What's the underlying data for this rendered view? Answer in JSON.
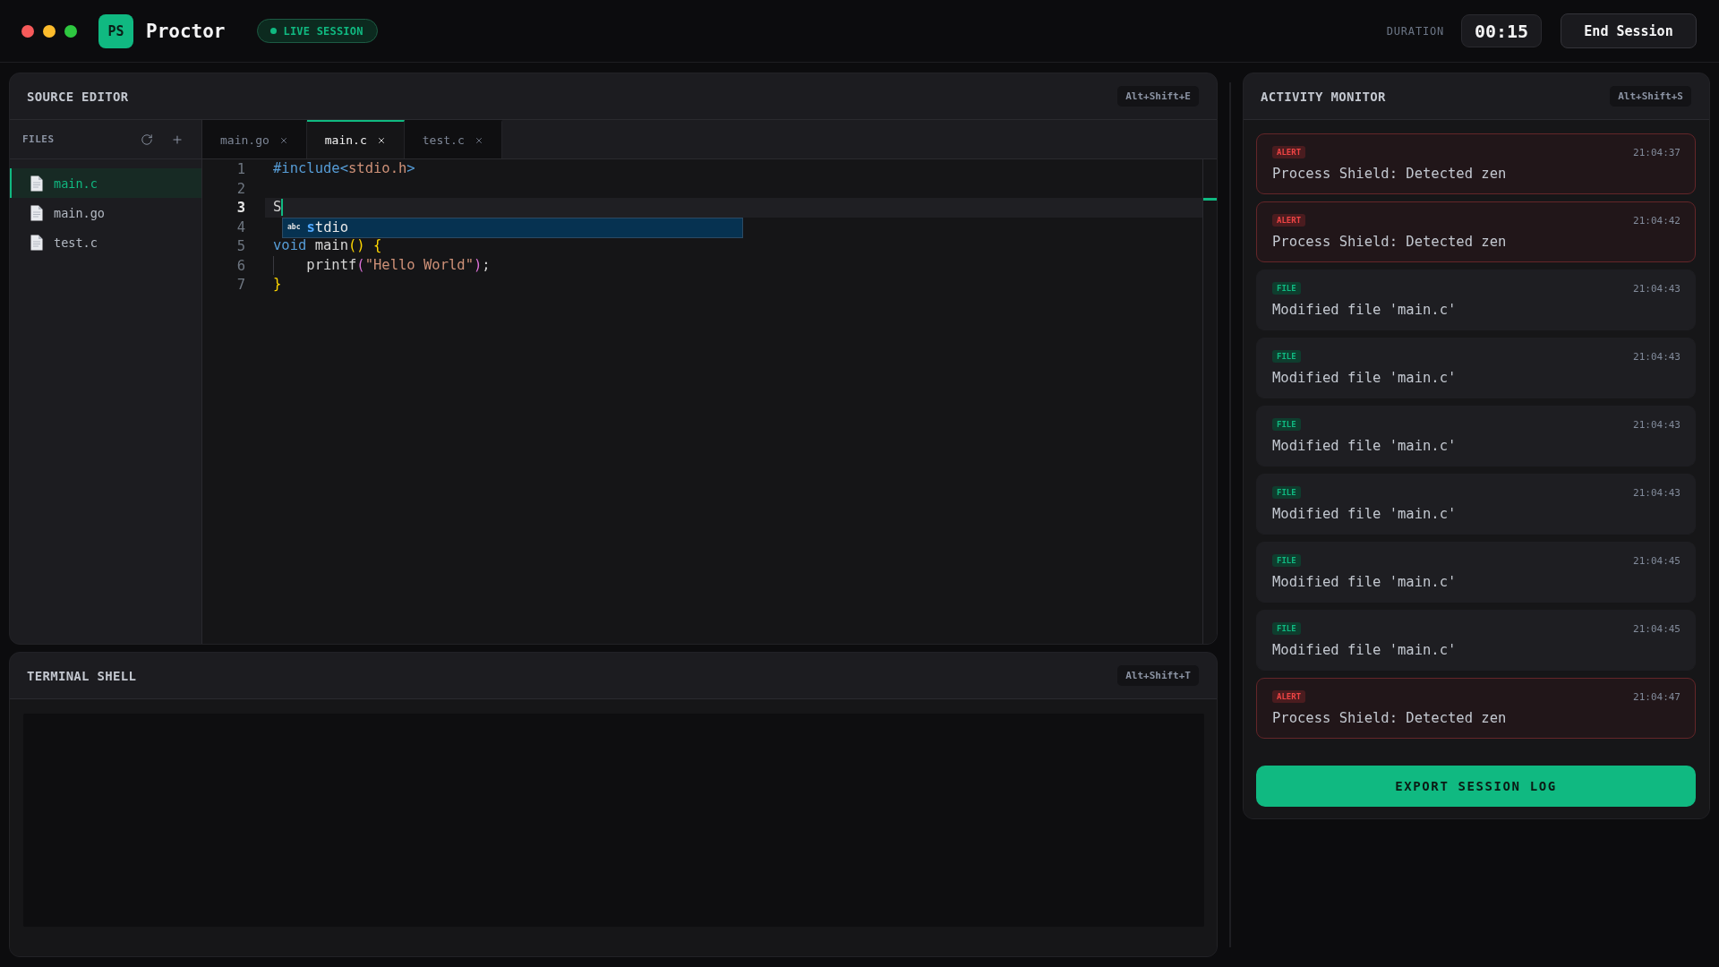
{
  "window": {
    "controls": [
      {
        "color": "#f75a5a"
      },
      {
        "color": "#fdbc2c"
      },
      {
        "color": "#2ec840"
      }
    ]
  },
  "header": {
    "logo": "PS",
    "app_name": "Proctor",
    "session_status": {
      "label": "LIVE SESSION",
      "live": true
    },
    "duration_label": "DURATION",
    "duration": "00:15",
    "end_button": "End Session"
  },
  "editor": {
    "title": "SOURCE EDITOR",
    "shortcut": "Alt+Shift+E",
    "files_heading": "FILES",
    "files": [
      {
        "name": "main.c",
        "selected": true
      },
      {
        "name": "main.go",
        "selected": false
      },
      {
        "name": "test.c",
        "selected": false
      }
    ],
    "tabs": [
      {
        "label": "main.go",
        "selected": false
      },
      {
        "label": "main.c",
        "selected": true
      },
      {
        "label": "test.c",
        "selected": false
      }
    ],
    "lines": [
      {
        "number": "1",
        "current": false,
        "indented": false,
        "tokens": [
          {
            "kind": "keyword",
            "text": "#include<"
          },
          {
            "kind": "string",
            "text": "stdio.h"
          },
          {
            "kind": "keyword",
            "text": ">"
          }
        ]
      },
      {
        "number": "2",
        "current": false,
        "indented": false
      },
      {
        "number": "3",
        "current": true,
        "indented": false,
        "tokens": [
          {
            "kind": "plain",
            "text": "S"
          }
        ]
      },
      {
        "number": "4",
        "current": false,
        "indented": false
      },
      {
        "number": "5",
        "current": false,
        "indented": false,
        "tokens": [
          {
            "kind": "keyword",
            "text": "void"
          },
          {
            "kind": "plain",
            "text": " main"
          },
          {
            "kind": "bracket",
            "text": "()"
          },
          {
            "kind": "bracket",
            "text": " {"
          }
        ]
      },
      {
        "number": "6",
        "current": false,
        "indented": true,
        "tokens": [
          {
            "kind": "plain",
            "text": "printf"
          },
          {
            "kind": "paren",
            "text": "("
          },
          {
            "kind": "string",
            "text": "\"Hello World\""
          },
          {
            "kind": "paren",
            "text": ")"
          },
          {
            "kind": "plain",
            "text": ";"
          }
        ]
      },
      {
        "number": "7",
        "current": false,
        "indented": false,
        "tokens": [
          {
            "kind": "bracket",
            "text": "}"
          }
        ]
      }
    ],
    "autocomplete": {
      "type_label": "abc",
      "matched": "s",
      "rest": "tdio"
    }
  },
  "terminal": {
    "title": "TERMINAL SHELL",
    "shortcut": "Alt+Shift+T"
  },
  "activity": {
    "title": "ACTIVITY MONITOR",
    "shortcut": "Alt+Shift+S",
    "events": [
      {
        "kind": "alert",
        "badge": "ALERT",
        "time": "21:04:37",
        "message": "Process Shield: Detected zen"
      },
      {
        "kind": "alert",
        "badge": "ALERT",
        "time": "21:04:42",
        "message": "Process Shield: Detected zen"
      },
      {
        "kind": "file",
        "badge": "FILE",
        "time": "21:04:43",
        "message": "Modified file 'main.c'"
      },
      {
        "kind": "file",
        "badge": "FILE",
        "time": "21:04:43",
        "message": "Modified file 'main.c'"
      },
      {
        "kind": "file",
        "badge": "FILE",
        "time": "21:04:43",
        "message": "Modified file 'main.c'"
      },
      {
        "kind": "file",
        "badge": "FILE",
        "time": "21:04:43",
        "message": "Modified file 'main.c'"
      },
      {
        "kind": "file",
        "badge": "FILE",
        "time": "21:04:45",
        "message": "Modified file 'main.c'"
      },
      {
        "kind": "file",
        "badge": "FILE",
        "time": "21:04:45",
        "message": "Modified file 'main.c'"
      },
      {
        "kind": "alert",
        "badge": "ALERT",
        "time": "21:04:47",
        "message": "Process Shield: Detected zen"
      }
    ],
    "export_button": "EXPORT SESSION LOG"
  }
}
